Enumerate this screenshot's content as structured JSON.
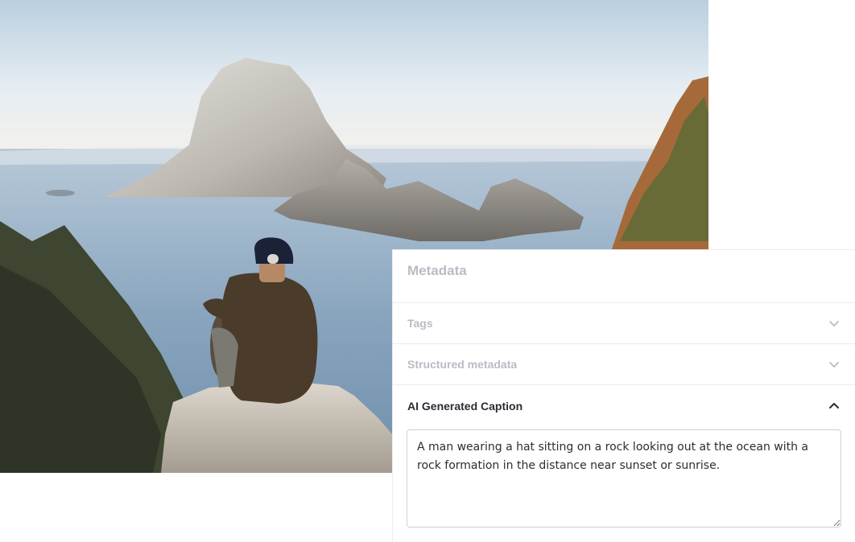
{
  "panel": {
    "title": "Metadata",
    "sections": [
      {
        "label": "Tags",
        "state": "collapsed",
        "icon": "chevron-down-icon"
      },
      {
        "label": "Structured metadata",
        "state": "collapsed",
        "icon": "chevron-down-icon"
      },
      {
        "label": "AI Generated Caption",
        "state": "expanded",
        "icon": "chevron-up-icon"
      }
    ],
    "caption": "A man wearing a hat sitting on a rock looking out at the ocean with a rock formation in the distance near sunset or sunrise."
  }
}
